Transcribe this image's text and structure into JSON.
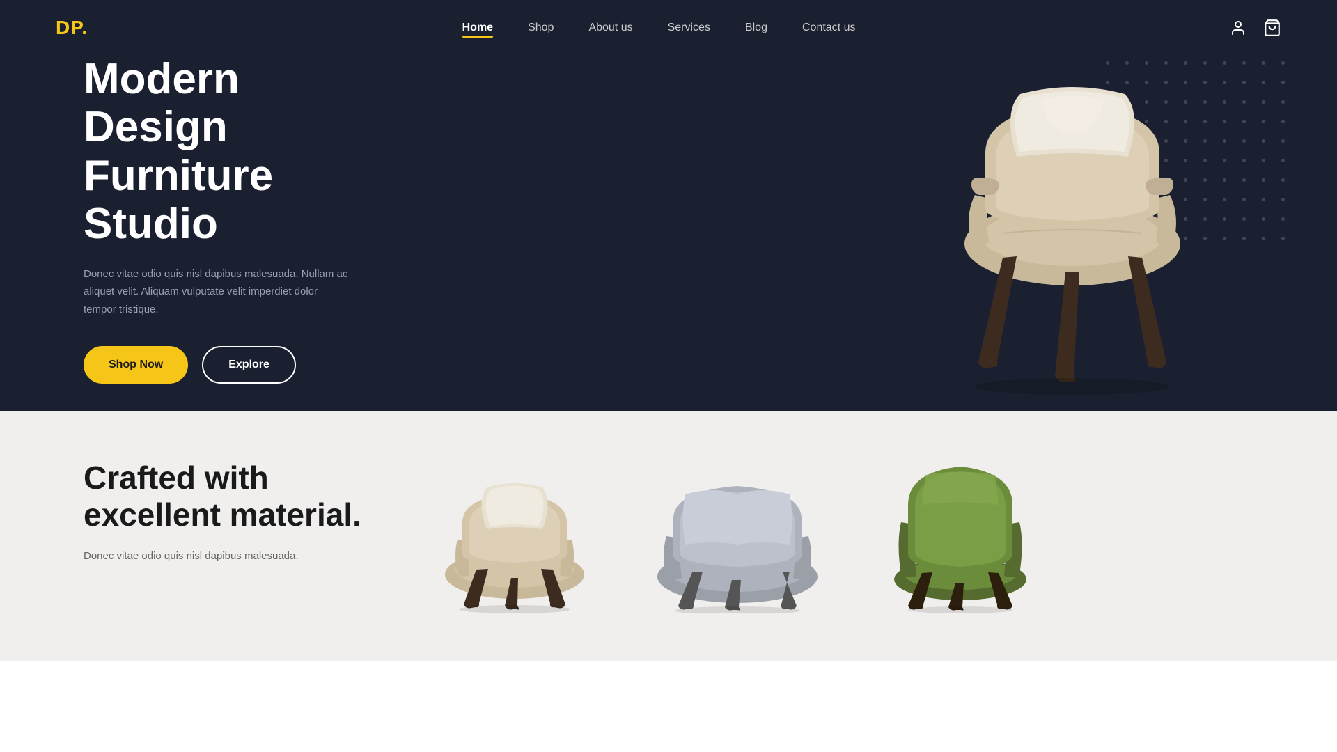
{
  "brand": {
    "name": "DP",
    "dot": "."
  },
  "nav": {
    "links": [
      {
        "label": "Home",
        "active": true
      },
      {
        "label": "Shop",
        "active": false
      },
      {
        "label": "About us",
        "active": false
      },
      {
        "label": "Services",
        "active": false
      },
      {
        "label": "Blog",
        "active": false
      },
      {
        "label": "Contact us",
        "active": false
      }
    ]
  },
  "hero": {
    "title_line1": "Modern Design",
    "title_line2": "Furniture Studio",
    "description": "Donec vitae odio quis nisl dapibus malesuada. Nullam ac aliquet velit. Aliquam vulputate velit imperdiet dolor tempor tristique.",
    "btn_primary": "Shop Now",
    "btn_secondary": "Explore"
  },
  "section2": {
    "title_line1": "Crafted with",
    "title_line2": "excellent material.",
    "description": "Donec vitae odio quis nisl dapibus malesuada."
  },
  "colors": {
    "hero_bg": "#1a2030",
    "accent": "#f5c518",
    "section2_bg": "#f0efed"
  },
  "icons": {
    "user": "👤",
    "cart": "🛒"
  }
}
